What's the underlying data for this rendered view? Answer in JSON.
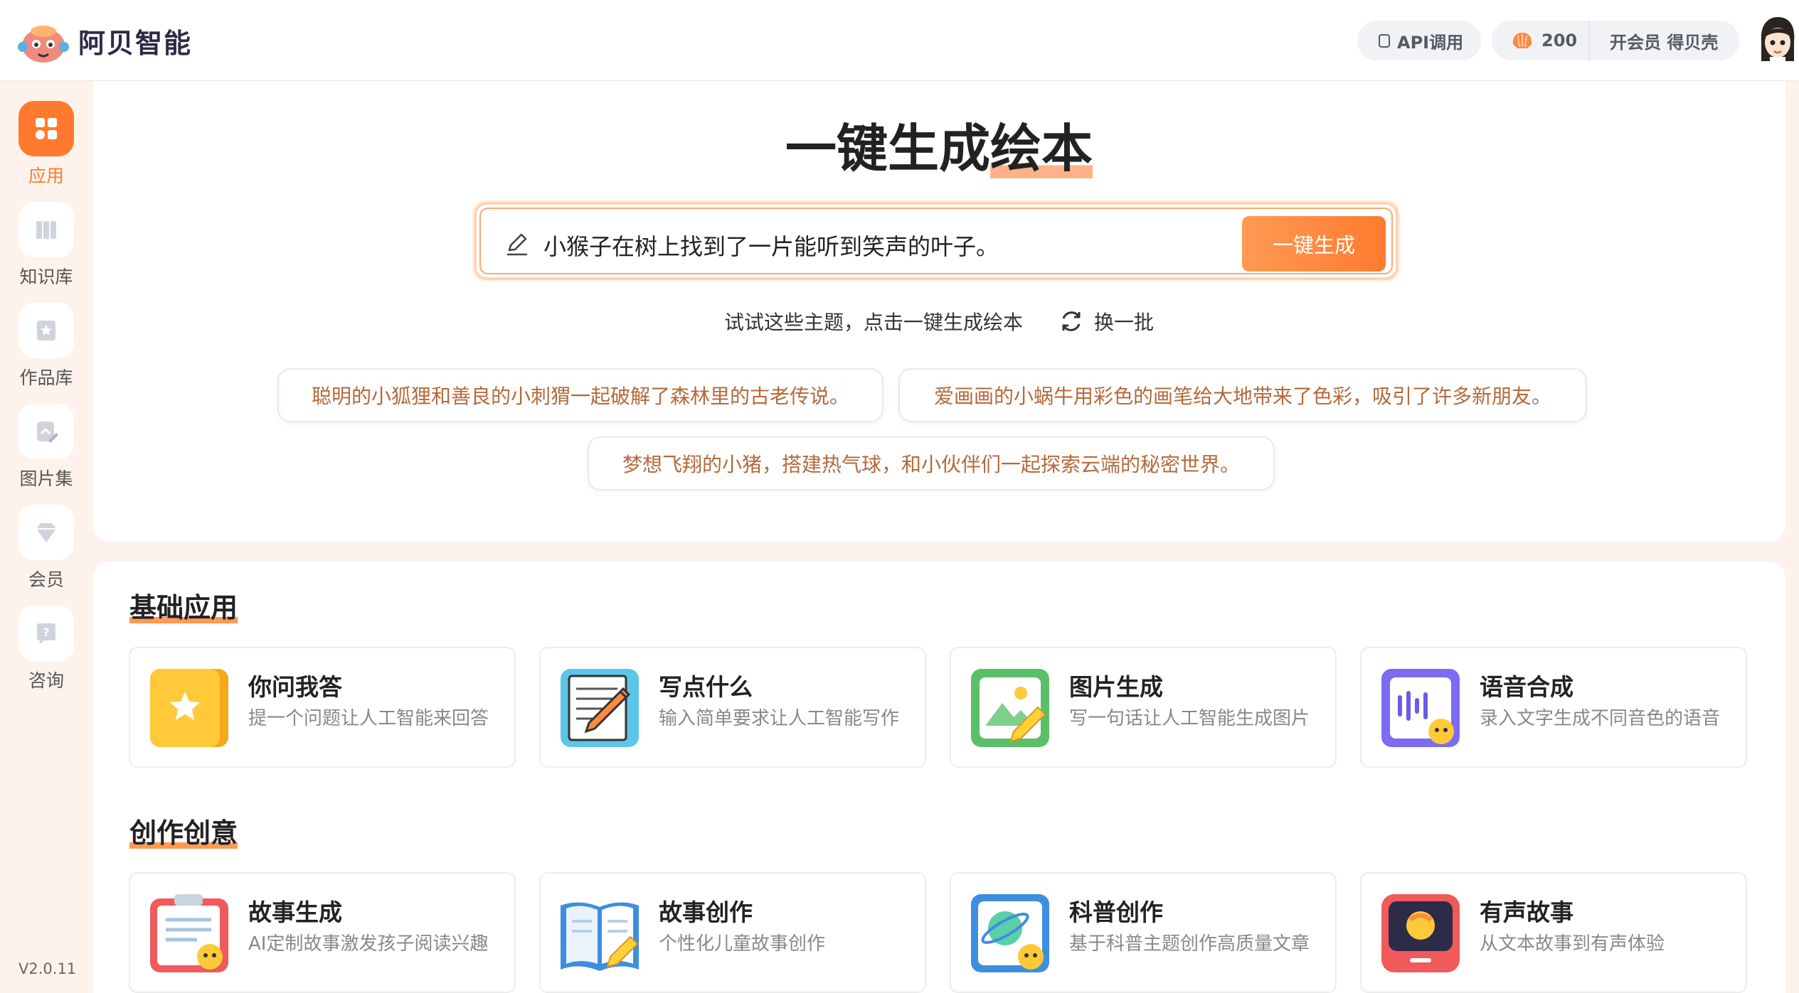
{
  "header": {
    "brand": "阿贝智能",
    "api_label": "API调用",
    "coins": "200",
    "vip_label": "开会员 得贝壳"
  },
  "sidebar": {
    "items": [
      {
        "label": "应用",
        "icon": "apps-icon",
        "active": true
      },
      {
        "label": "知识库",
        "icon": "books-icon",
        "active": false
      },
      {
        "label": "作品库",
        "icon": "portfolio-icon",
        "active": false
      },
      {
        "label": "图片集",
        "icon": "image-collection-icon",
        "active": false
      },
      {
        "label": "会员",
        "icon": "diamond-icon",
        "active": false
      },
      {
        "label": "咨询",
        "icon": "help-icon",
        "active": false
      }
    ],
    "version": "V2.0.11"
  },
  "hero": {
    "title_main": "一键生成",
    "title_highlight": "绘本",
    "input_value": "小猴子在树上找到了一片能听到笑声的叶子。",
    "generate_label": "一键生成",
    "hint": "试试这些主题，点击一键生成绘本",
    "refresh_label": "换一批",
    "suggestions": [
      "聪明的小狐狸和善良的小刺猬一起破解了森林里的古老传说。",
      "爱画画的小蜗牛用彩色的画笔给大地带来了色彩，吸引了许多新朋友。",
      "梦想飞翔的小猪，搭建热气球，和小伙伴们一起探索云端的秘密世界。"
    ]
  },
  "sections": [
    {
      "title": "基础应用",
      "cards": [
        {
          "title": "你问我答",
          "desc": "提一个问题让人工智能来回答",
          "icon": "star-qa-icon"
        },
        {
          "title": "写点什么",
          "desc": "输入简单要求让人工智能写作",
          "icon": "pen-paper-icon"
        },
        {
          "title": "图片生成",
          "desc": "写一句话让人工智能生成图片",
          "icon": "image-gen-icon"
        },
        {
          "title": "语音合成",
          "desc": "录入文字生成不同音色的语音",
          "icon": "voice-wave-icon"
        }
      ]
    },
    {
      "title": "创作创意",
      "cards": [
        {
          "title": "故事生成",
          "desc": "AI定制故事激发孩子阅读兴趣",
          "icon": "clipboard-story-icon"
        },
        {
          "title": "故事创作",
          "desc": "个性化儿童故事创作",
          "icon": "open-book-icon"
        },
        {
          "title": "科普创作",
          "desc": "基于科普主题创作高质量文章",
          "icon": "planet-science-icon"
        },
        {
          "title": "有声故事",
          "desc": "从文本故事到有声体验",
          "icon": "audio-story-icon"
        }
      ]
    }
  ],
  "colors": {
    "accent": "#ff7a2e",
    "chip_text": "#b5693a",
    "page_bg": "#fdf3ec"
  }
}
